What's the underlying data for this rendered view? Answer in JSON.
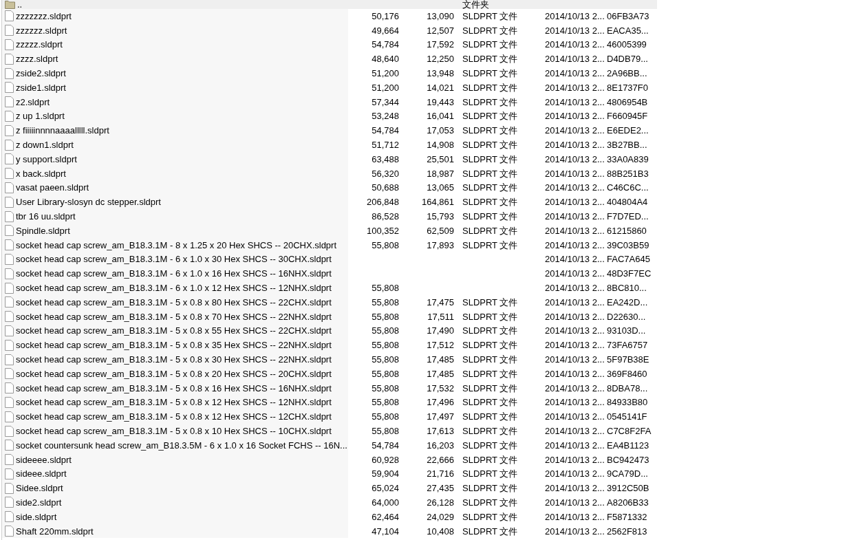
{
  "parent_row": {
    "name": "..",
    "type": "文件夹"
  },
  "files": [
    {
      "name": "zzzzzzz.sldprt",
      "size": "50,176",
      "packed": "13,090",
      "type": "SLDPRT 文件",
      "modified": "2014/10/13 2...",
      "crc": "06FB3A73"
    },
    {
      "name": "zzzzzz.sldprt",
      "size": "49,664",
      "packed": "12,507",
      "type": "SLDPRT 文件",
      "modified": "2014/10/13 2...",
      "crc": "EACA35..."
    },
    {
      "name": "zzzzz.sldprt",
      "size": "54,784",
      "packed": "17,592",
      "type": "SLDPRT 文件",
      "modified": "2014/10/13 2...",
      "crc": "46005399"
    },
    {
      "name": "zzzz.sldprt",
      "size": "48,640",
      "packed": "12,250",
      "type": "SLDPRT 文件",
      "modified": "2014/10/13 2...",
      "crc": "D4DB79..."
    },
    {
      "name": "zside2.sldprt",
      "size": "51,200",
      "packed": "13,948",
      "type": "SLDPRT 文件",
      "modified": "2014/10/13 2...",
      "crc": "2A96BB..."
    },
    {
      "name": "zside1.sldprt",
      "size": "51,200",
      "packed": "14,021",
      "type": "SLDPRT 文件",
      "modified": "2014/10/13 2...",
      "crc": "8E1737F0"
    },
    {
      "name": "z2.sldprt",
      "size": "57,344",
      "packed": "19,443",
      "type": "SLDPRT 文件",
      "modified": "2014/10/13 2...",
      "crc": "4806954B"
    },
    {
      "name": "z up 1.sldprt",
      "size": "53,248",
      "packed": "16,041",
      "type": "SLDPRT 文件",
      "modified": "2014/10/13 2...",
      "crc": "F660945F"
    },
    {
      "name": "z fiiiiinnnnaaaalllll.sldprt",
      "size": "54,784",
      "packed": "17,053",
      "type": "SLDPRT 文件",
      "modified": "2014/10/13 2...",
      "crc": "E6EDE2..."
    },
    {
      "name": "z down1.sldprt",
      "size": "51,712",
      "packed": "14,908",
      "type": "SLDPRT 文件",
      "modified": "2014/10/13 2...",
      "crc": "3B27BB..."
    },
    {
      "name": "y support.sldprt",
      "size": "63,488",
      "packed": "25,501",
      "type": "SLDPRT 文件",
      "modified": "2014/10/13 2...",
      "crc": "33A0A839"
    },
    {
      "name": "x back.sldprt",
      "size": "56,320",
      "packed": "18,987",
      "type": "SLDPRT 文件",
      "modified": "2014/10/13 2...",
      "crc": "88B251B3"
    },
    {
      "name": "vasat paeen.sldprt",
      "size": "50,688",
      "packed": "13,065",
      "type": "SLDPRT 文件",
      "modified": "2014/10/13 2...",
      "crc": "C46C6C..."
    },
    {
      "name": "User Library-slosyn dc stepper.sldprt",
      "size": "206,848",
      "packed": "164,861",
      "type": "SLDPRT 文件",
      "modified": "2014/10/13 2...",
      "crc": "404804A4"
    },
    {
      "name": "tbr 16 uu.sldprt",
      "size": "86,528",
      "packed": "15,793",
      "type": "SLDPRT 文件",
      "modified": "2014/10/13 2...",
      "crc": "F7D7ED..."
    },
    {
      "name": "Spindle.sldprt",
      "size": "100,352",
      "packed": "62,509",
      "type": "SLDPRT 文件",
      "modified": "2014/10/13 2...",
      "crc": "61215860"
    },
    {
      "name": "socket head cap screw_am_B18.3.1M - 8 x 1.25 x 20 Hex SHCS -- 20CHX.sldprt",
      "size": "55,808",
      "packed": "17,893",
      "type": "SLDPRT 文件",
      "modified": "2014/10/13 2...",
      "crc": "39C03B59"
    },
    {
      "name": "socket head cap screw_am_B18.3.1M - 6 x 1.0 x 30 Hex SHCS -- 30CHX.sldprt",
      "modified": "2014/10/13 2...",
      "crc": "FAC7A645"
    },
    {
      "name": "socket head cap screw_am_B18.3.1M - 6 x 1.0 x 16 Hex SHCS -- 16NHX.sldprt",
      "modified": "2014/10/13 2...",
      "crc": "48D3F7EC"
    },
    {
      "name": "socket head cap screw_am_B18.3.1M - 6 x 1.0 x 12 Hex SHCS -- 12NHX.sldprt",
      "size": "55,808",
      "modified": "2014/10/13 2...",
      "crc": "8BC810..."
    },
    {
      "name": "socket head cap screw_am_B18.3.1M - 5 x 0.8 x 80 Hex SHCS -- 22CHX.sldprt",
      "size": "55,808",
      "packed": "17,475",
      "type": "SLDPRT 文件",
      "modified": "2014/10/13 2...",
      "crc": "EA242D..."
    },
    {
      "name": "socket head cap screw_am_B18.3.1M - 5 x 0.8 x 70 Hex SHCS -- 22NHX.sldprt",
      "size": "55,808",
      "packed": "17,511",
      "type": "SLDPRT 文件",
      "modified": "2014/10/13 2...",
      "crc": "D22630..."
    },
    {
      "name": "socket head cap screw_am_B18.3.1M - 5 x 0.8 x 55 Hex SHCS -- 22CHX.sldprt",
      "size": "55,808",
      "packed": "17,490",
      "type": "SLDPRT 文件",
      "modified": "2014/10/13 2...",
      "crc": "93103D..."
    },
    {
      "name": "socket head cap screw_am_B18.3.1M - 5 x 0.8 x 35 Hex SHCS -- 22NHX.sldprt",
      "size": "55,808",
      "packed": "17,512",
      "type": "SLDPRT 文件",
      "modified": "2014/10/13 2...",
      "crc": "73FA6757"
    },
    {
      "name": "socket head cap screw_am_B18.3.1M - 5 x 0.8 x 30 Hex SHCS -- 22NHX.sldprt",
      "size": "55,808",
      "packed": "17,485",
      "type": "SLDPRT 文件",
      "modified": "2014/10/13 2...",
      "crc": "5F97B38E"
    },
    {
      "name": "socket head cap screw_am_B18.3.1M - 5 x 0.8 x 20 Hex SHCS -- 20CHX.sldprt",
      "size": "55,808",
      "packed": "17,485",
      "type": "SLDPRT 文件",
      "modified": "2014/10/13 2...",
      "crc": "369F8460"
    },
    {
      "name": "socket head cap screw_am_B18.3.1M - 5 x 0.8 x 16 Hex SHCS -- 16NHX.sldprt",
      "size": "55,808",
      "packed": "17,532",
      "type": "SLDPRT 文件",
      "modified": "2014/10/13 2...",
      "crc": "8DBA78..."
    },
    {
      "name": "socket head cap screw_am_B18.3.1M - 5 x 0.8 x 12 Hex SHCS -- 12NHX.sldprt",
      "size": "55,808",
      "packed": "17,496",
      "type": "SLDPRT 文件",
      "modified": "2014/10/13 2...",
      "crc": "84933B80"
    },
    {
      "name": "socket head cap screw_am_B18.3.1M - 5 x 0.8 x 12 Hex SHCS -- 12CHX.sldprt",
      "size": "55,808",
      "packed": "17,497",
      "type": "SLDPRT 文件",
      "modified": "2014/10/13 2...",
      "crc": "0545141F"
    },
    {
      "name": "socket head cap screw_am_B18.3.1M - 5 x 0.8 x 10 Hex SHCS -- 10CHX.sldprt",
      "size": "55,808",
      "packed": "17,613",
      "type": "SLDPRT 文件",
      "modified": "2014/10/13 2...",
      "crc": "C7C8F2FA"
    },
    {
      "name": "socket countersunk head screw_am_B18.3.5M - 6 x 1.0 x 16 Socket FCHS  -- 16N....",
      "size": "54,784",
      "packed": "16,203",
      "type": "SLDPRT 文件",
      "modified": "2014/10/13 2...",
      "crc": "EA4B1123"
    },
    {
      "name": "sideeee.sldprt",
      "size": "60,928",
      "packed": "22,666",
      "type": "SLDPRT 文件",
      "modified": "2014/10/13 2...",
      "crc": "BC942473"
    },
    {
      "name": "sideee.sldprt",
      "size": "59,904",
      "packed": "21,716",
      "type": "SLDPRT 文件",
      "modified": "2014/10/13 2...",
      "crc": "9CA79D..."
    },
    {
      "name": "Sidee.sldprt",
      "size": "65,024",
      "packed": "27,435",
      "type": "SLDPRT 文件",
      "modified": "2014/10/13 2...",
      "crc": "3912C50B"
    },
    {
      "name": "side2.sldprt",
      "size": "64,000",
      "packed": "26,128",
      "type": "SLDPRT 文件",
      "modified": "2014/10/13 2...",
      "crc": "A8206B33"
    },
    {
      "name": "side.sldprt",
      "size": "62,464",
      "packed": "24,029",
      "type": "SLDPRT 文件",
      "modified": "2014/10/13 2...",
      "crc": "F5871332"
    },
    {
      "name": "Shaft 220mm.sldprt",
      "size": "47,104",
      "packed": "10,408",
      "type": "SLDPRT 文件",
      "modified": "2014/10/13 2...",
      "crc": "2562F813"
    }
  ]
}
